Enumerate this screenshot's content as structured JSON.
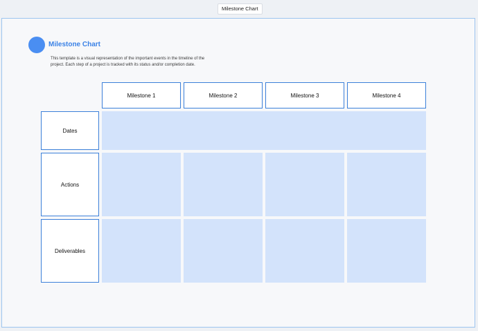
{
  "tab": {
    "label": "Milestone Chart"
  },
  "header": {
    "title": "Milestone Chart",
    "description": "This template is a visual representation of the important events in the timeline of the project. Each step of a project is tracked with its status and/or completion date."
  },
  "columns": [
    "Milestone 1",
    "Milestone 2",
    "Milestone 3",
    "Milestone 4"
  ],
  "rows": [
    "Dates",
    "Actions",
    "Deliverables"
  ],
  "colors": {
    "accent": "#3b82e6",
    "cell_fill": "#d3e3fb",
    "border": "#3b7fd9"
  }
}
